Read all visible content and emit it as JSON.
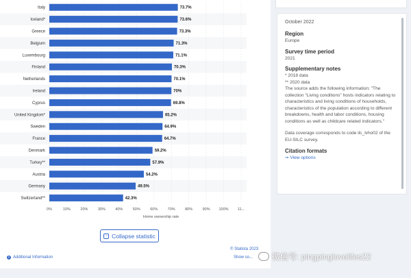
{
  "chart_data": {
    "type": "bar",
    "orientation": "horizontal",
    "categories": [
      "Italy",
      "Iceland*",
      "Greece",
      "Belgium",
      "Luxembourg",
      "Finland",
      "Netherlands",
      "Ireland",
      "Cyprus",
      "United Kingdom*",
      "Sweden",
      "France",
      "Denmark",
      "Turkey**",
      "Austria",
      "Germany",
      "Switzerland**"
    ],
    "values": [
      73.7,
      73.6,
      73.3,
      71.3,
      71.1,
      70.3,
      70.1,
      70,
      69.8,
      65.2,
      64.9,
      64.7,
      59.2,
      57.9,
      54.2,
      49.5,
      42.3
    ],
    "value_labels": [
      "73.7%",
      "73.6%",
      "73.3%",
      "71.3%",
      "71.1%",
      "70.3%",
      "70.1%",
      "70%",
      "69.8%",
      "65.2%",
      "64.9%",
      "64.7%",
      "59.2%",
      "57.9%",
      "54.2%",
      "49.5%",
      "42.3%"
    ],
    "ticks": [
      "0%",
      "10%",
      "20%",
      "30%",
      "40%",
      "50%",
      "60%",
      "70%",
      "80%",
      "90%",
      "100%",
      "11..."
    ],
    "xlabel": "Home ownership rate",
    "xlim": [
      0,
      110
    ],
    "bar_color": "#3468c8"
  },
  "footer": {
    "collapse_label": "Collapse statistic",
    "copyright": "© Statista 2023",
    "show_source": "Show so...",
    "additional_info": "Additional Information"
  },
  "side": {
    "date": "October 2022",
    "region_label": "Region",
    "region_value": "Europe",
    "period_label": "Survey time period",
    "period_value": "2021",
    "notes_label": "Supplementary notes",
    "notes_1": "* 2018 data",
    "notes_2": "** 2020 data",
    "notes_3": "The source adds the following information: \"The collection \"Living conditions\" hosts indicators relating to characteristics and living conditions of households, characteristics of the population according to different breakdowns, health and labor conditions, housing conditions as well as childcare related indicators.\"",
    "notes_4": "Data coverage corresponds to code ilc_lvho02 of the EU-SILC survey.",
    "citation_label": "Citation formats",
    "view_options": "View options"
  },
  "watermark": "微信号: pingpinglovelifes22"
}
